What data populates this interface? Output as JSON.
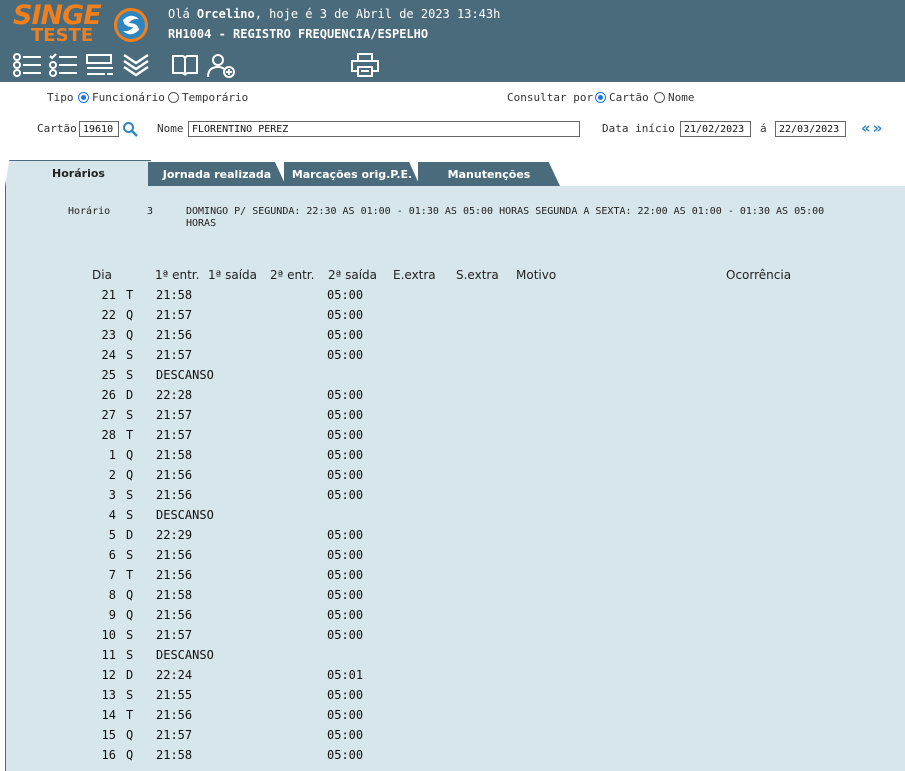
{
  "header": {
    "logo_main": "SINGE",
    "logo_sub": "TESTE",
    "greeting_prefix": "Olá ",
    "user_name": "Orcelino",
    "greeting_suffix": ", hoje é 3 de Abril de 2023 13:43h",
    "program_title": "RH1004 - REGISTRO FREQUENCIA/ESPELHO"
  },
  "toolbar": {
    "icons": [
      "list-icon",
      "checklist-icon",
      "form-list-icon",
      "expand-down-icon",
      "book-icon",
      "add-user-icon",
      "printer-icon"
    ]
  },
  "form": {
    "tipo_label": "Tipo",
    "tipo_options": [
      "Funcionário",
      "Temporário"
    ],
    "tipo_selected": "Funcionário",
    "consultar_label": "Consultar por",
    "consultar_options": [
      "Cartão",
      "Nome"
    ],
    "consultar_selected": "Cartão",
    "cartao_label": "Cartão",
    "cartao_value": "19610",
    "nome_label": "Nome",
    "nome_value": "FLORENTINO PEREZ",
    "data_inicio_label": "Data início",
    "data_inicio_value": "21/02/2023",
    "data_fim_label": "á",
    "data_fim_value": "22/03/2023",
    "nav_arrows": "«»"
  },
  "tabs": [
    {
      "label": "Horários",
      "active": true
    },
    {
      "label": "Jornada realizada",
      "active": false
    },
    {
      "label": "Marcações orig.P.E.",
      "active": false
    },
    {
      "label": "Manutenções",
      "active": false
    }
  ],
  "horario": {
    "label": "Horário",
    "number": "3",
    "description": "DOMINGO P/ SEGUNDA: 22:30 AS 01:00 - 01:30 AS 05:00 HORAS SEGUNDA A SEXTA: 22:00 AS 01:00 - 01:30 AS 05:00 HORAS"
  },
  "table": {
    "headers": {
      "dia": "Dia",
      "entr1": "1ª entr.",
      "saida1": "1ª saída",
      "entr2": "2ª entr.",
      "saida2": "2ª saída",
      "eextra": "E.extra",
      "sextra": "S.extra",
      "motivo": "Motivo",
      "ocorrencia": "Ocorrência"
    },
    "rows": [
      {
        "dia": "21",
        "wd": "T",
        "entr1": "21:58",
        "saida2": "05:00"
      },
      {
        "dia": "22",
        "wd": "Q",
        "entr1": "21:57",
        "saida2": "05:00"
      },
      {
        "dia": "23",
        "wd": "Q",
        "entr1": "21:56",
        "saida2": "05:00"
      },
      {
        "dia": "24",
        "wd": "S",
        "entr1": "21:57",
        "saida2": "05:00"
      },
      {
        "dia": "25",
        "wd": "S",
        "entr1": "DESCANSO",
        "saida2": ""
      },
      {
        "dia": "26",
        "wd": "D",
        "entr1": "22:28",
        "saida2": "05:00"
      },
      {
        "dia": "27",
        "wd": "S",
        "entr1": "21:57",
        "saida2": "05:00"
      },
      {
        "dia": "28",
        "wd": "T",
        "entr1": "21:57",
        "saida2": "05:00"
      },
      {
        "dia": "1",
        "wd": "Q",
        "entr1": "21:58",
        "saida2": "05:00"
      },
      {
        "dia": "2",
        "wd": "Q",
        "entr1": "21:56",
        "saida2": "05:00"
      },
      {
        "dia": "3",
        "wd": "S",
        "entr1": "21:56",
        "saida2": "05:00"
      },
      {
        "dia": "4",
        "wd": "S",
        "entr1": "DESCANSO",
        "saida2": ""
      },
      {
        "dia": "5",
        "wd": "D",
        "entr1": "22:29",
        "saida2": "05:00"
      },
      {
        "dia": "6",
        "wd": "S",
        "entr1": "21:56",
        "saida2": "05:00"
      },
      {
        "dia": "7",
        "wd": "T",
        "entr1": "21:56",
        "saida2": "05:00"
      },
      {
        "dia": "8",
        "wd": "Q",
        "entr1": "21:58",
        "saida2": "05:00"
      },
      {
        "dia": "9",
        "wd": "Q",
        "entr1": "21:56",
        "saida2": "05:00"
      },
      {
        "dia": "10",
        "wd": "S",
        "entr1": "21:57",
        "saida2": "05:00"
      },
      {
        "dia": "11",
        "wd": "S",
        "entr1": "DESCANSO",
        "saida2": ""
      },
      {
        "dia": "12",
        "wd": "D",
        "entr1": "22:24",
        "saida2": "05:01"
      },
      {
        "dia": "13",
        "wd": "S",
        "entr1": "21:55",
        "saida2": "05:00"
      },
      {
        "dia": "14",
        "wd": "T",
        "entr1": "21:56",
        "saida2": "05:00"
      },
      {
        "dia": "15",
        "wd": "Q",
        "entr1": "21:57",
        "saida2": "05:00"
      },
      {
        "dia": "16",
        "wd": "Q",
        "entr1": "21:58",
        "saida2": "05:00"
      }
    ]
  },
  "colors": {
    "header_bg": "#4a6b7c",
    "logo_orange": "#f07f1c",
    "content_bg": "#d6e6ea",
    "accent_blue": "#2e86c1"
  }
}
